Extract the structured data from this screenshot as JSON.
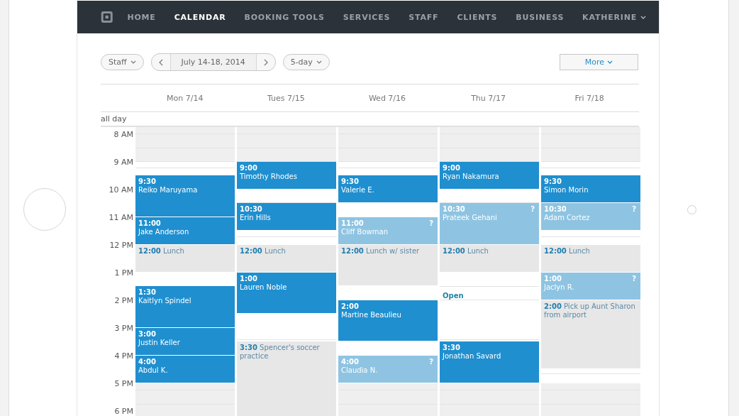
{
  "nav": {
    "items": [
      {
        "label": "HOME",
        "selected": false
      },
      {
        "label": "CALENDAR",
        "selected": true
      },
      {
        "label": "BOOKING TOOLS",
        "selected": false
      },
      {
        "label": "SERVICES",
        "selected": false
      },
      {
        "label": "STAFF",
        "selected": false
      },
      {
        "label": "CLIENTS",
        "selected": false
      },
      {
        "label": "BUSINESS",
        "selected": false
      }
    ],
    "user": "KATHERINE"
  },
  "toolbar": {
    "staff": "Staff",
    "date_range": "July 14-18, 2014",
    "view": "5-day",
    "more": "More"
  },
  "all_day_label": "all day",
  "hours": [
    "8 AM",
    "9 AM",
    "10 AM",
    "11 AM",
    "12 PM",
    "1 PM",
    "2 PM",
    "3 PM",
    "4 PM",
    "5 PM",
    "6 PM"
  ],
  "days": [
    {
      "label": "Mon 7/14",
      "blocks": [
        {
          "kind": "closed-lead"
        },
        {
          "kind": "free"
        },
        {
          "kind": "confirmed",
          "time": "9:30",
          "title": "Reiko Maruyama"
        },
        {
          "kind": "more"
        },
        {
          "kind": "more"
        },
        {
          "kind": "confirmed",
          "time": "11:00",
          "title": "Jake Anderson"
        },
        {
          "kind": "more"
        },
        {
          "kind": "personal",
          "time": "12:00",
          "title": "Lunch"
        },
        {
          "kind": "more"
        },
        {
          "kind": "free"
        },
        {
          "kind": "confirmed",
          "time": "1:30",
          "title": "Kaitlyn Spindel"
        },
        {
          "kind": "more"
        },
        {
          "kind": "more"
        },
        {
          "kind": "confirmed",
          "time": "3:00",
          "title": "Justin Keller"
        },
        {
          "kind": "more"
        },
        {
          "kind": "confirmed",
          "time": "4:00",
          "title": "Abdul K."
        },
        {
          "kind": "more"
        },
        {
          "kind": "closed"
        },
        {
          "kind": "more"
        },
        {
          "kind": "more"
        }
      ]
    },
    {
      "label": "Tues 7/15",
      "blocks": [
        {
          "kind": "closed-lead"
        },
        {
          "kind": "confirmed",
          "time": "9:00",
          "title": "Timothy Rhodes"
        },
        {
          "kind": "more"
        },
        {
          "kind": "free"
        },
        {
          "kind": "confirmed",
          "time": "10:30",
          "title": "Erin Hills"
        },
        {
          "kind": "more"
        },
        {
          "kind": "free"
        },
        {
          "kind": "personal",
          "time": "12:00",
          "title": "Lunch"
        },
        {
          "kind": "more"
        },
        {
          "kind": "confirmed",
          "time": "1:00",
          "title": "Lauren Noble"
        },
        {
          "kind": "more"
        },
        {
          "kind": "more"
        },
        {
          "kind": "free"
        },
        {
          "kind": "free"
        },
        {
          "kind": "personal",
          "time": "3:30",
          "title": "Spencer's soccer practice"
        },
        {
          "kind": "more"
        },
        {
          "kind": "more"
        },
        {
          "kind": "more"
        },
        {
          "kind": "more"
        },
        {
          "kind": "more"
        }
      ]
    },
    {
      "label": "Wed 7/16",
      "blocks": [
        {
          "kind": "closed-lead"
        },
        {
          "kind": "free"
        },
        {
          "kind": "confirmed",
          "time": "9:30",
          "title": "Valerie E."
        },
        {
          "kind": "more"
        },
        {
          "kind": "free"
        },
        {
          "kind": "pending",
          "time": "11:00",
          "title": "Cliff Bowman",
          "flag": "?"
        },
        {
          "kind": "more"
        },
        {
          "kind": "personal",
          "time": "12:00",
          "title": "Lunch w/ sister"
        },
        {
          "kind": "more"
        },
        {
          "kind": "more"
        },
        {
          "kind": "free"
        },
        {
          "kind": "confirmed",
          "time": "2:00",
          "title": "Martine Beaulieu"
        },
        {
          "kind": "more"
        },
        {
          "kind": "more"
        },
        {
          "kind": "free"
        },
        {
          "kind": "pending",
          "time": "4:00",
          "title": "Claudia N.",
          "flag": "?"
        },
        {
          "kind": "more"
        },
        {
          "kind": "closed"
        },
        {
          "kind": "more"
        },
        {
          "kind": "more"
        }
      ]
    },
    {
      "label": "Thu 7/17",
      "blocks": [
        {
          "kind": "closed-lead"
        },
        {
          "kind": "confirmed",
          "time": "9:00",
          "title": "Ryan Nakamura"
        },
        {
          "kind": "more"
        },
        {
          "kind": "free"
        },
        {
          "kind": "pending",
          "time": "10:30",
          "title": "Prateek Gehani",
          "flag": "?"
        },
        {
          "kind": "more"
        },
        {
          "kind": "more"
        },
        {
          "kind": "personal",
          "time": "12:00",
          "title": "Lunch"
        },
        {
          "kind": "more"
        },
        {
          "kind": "free"
        },
        {
          "kind": "open",
          "title": "Open"
        },
        {
          "kind": "free"
        },
        {
          "kind": "free"
        },
        {
          "kind": "free"
        },
        {
          "kind": "confirmed",
          "time": "3:30",
          "title": "Jonathan Savard"
        },
        {
          "kind": "more"
        },
        {
          "kind": "more"
        },
        {
          "kind": "closed"
        },
        {
          "kind": "more"
        },
        {
          "kind": "more"
        }
      ]
    },
    {
      "label": "Fri 7/18",
      "blocks": [
        {
          "kind": "closed-lead"
        },
        {
          "kind": "free"
        },
        {
          "kind": "confirmed",
          "time": "9:30",
          "title": "Simon Morin"
        },
        {
          "kind": "more"
        },
        {
          "kind": "pending",
          "time": "10:30",
          "title": "Adam Cortez",
          "flag": "?"
        },
        {
          "kind": "more"
        },
        {
          "kind": "free"
        },
        {
          "kind": "personal",
          "time": "12:00",
          "title": "Lunch"
        },
        {
          "kind": "more"
        },
        {
          "kind": "pending",
          "time": "1:00",
          "title": "Jaclyn R.",
          "flag": "?"
        },
        {
          "kind": "more"
        },
        {
          "kind": "personal",
          "time": "2:00",
          "title": "Pick up Aunt Sharon from airport"
        },
        {
          "kind": "more"
        },
        {
          "kind": "more"
        },
        {
          "kind": "more"
        },
        {
          "kind": "more"
        },
        {
          "kind": "free"
        },
        {
          "kind": "closed"
        },
        {
          "kind": "more"
        },
        {
          "kind": "more"
        }
      ]
    }
  ]
}
